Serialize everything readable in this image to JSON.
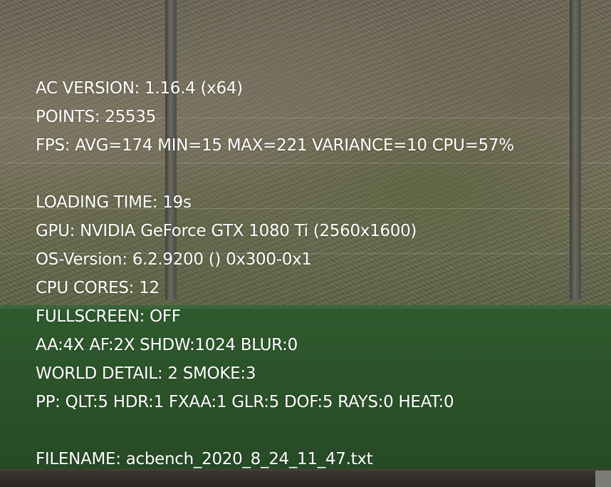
{
  "benchmark": {
    "ac_version": "AC VERSION: 1.16.4 (x64)",
    "points": "POINTS: 25535",
    "fps": "FPS: AVG=174 MIN=15 MAX=221 VARIANCE=10 CPU=57%",
    "loading_time": "LOADING TIME: 19s",
    "gpu": "GPU: NVIDIA GeForce GTX 1080 Ti (2560x1600)",
    "os_version": "OS-Version: 6.2.9200 () 0x300-0x1",
    "cpu_cores": "CPU CORES: 12",
    "fullscreen": "FULLSCREEN: OFF",
    "aa_settings": "AA:4X AF:2X SHDW:1024 BLUR:0",
    "world_detail": "WORLD DETAIL: 2 SMOKE:3",
    "pp_settings": "PP: QLT:5 HDR:1 FXAA:1 GLR:5 DOF:5 RAYS:0 HEAT:0",
    "filename": "FILENAME: acbench_2020_8_24_11_47.txt"
  },
  "colors": {
    "text": "#ffffff",
    "wall_green": "#2b5229",
    "hillside": "#7a735f"
  }
}
